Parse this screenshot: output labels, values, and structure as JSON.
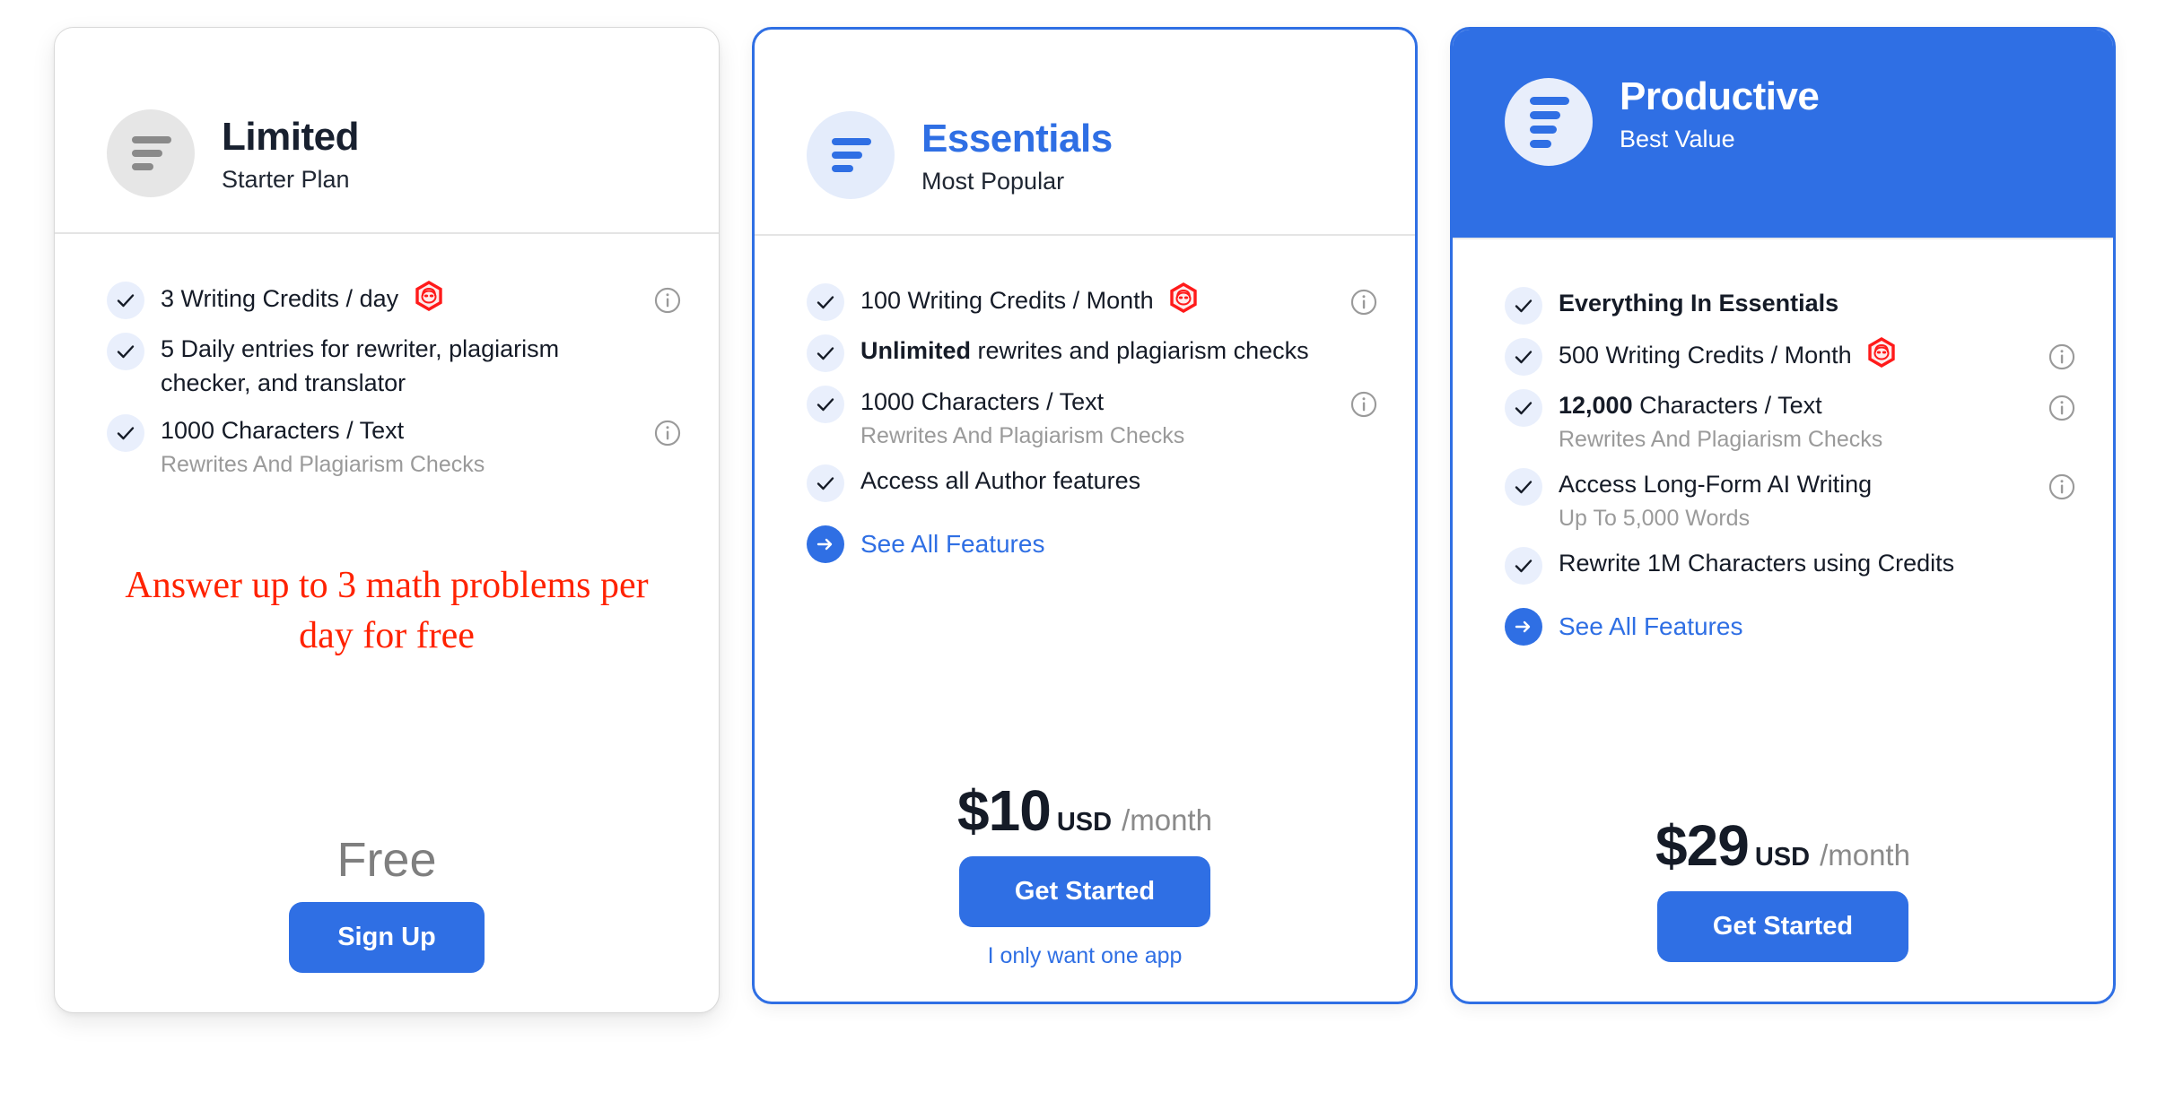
{
  "theme": {
    "accent": "#2f6fe4",
    "promo_red": "#ff2200",
    "muted": "#9a9a9a",
    "check_bg": "#e9effc"
  },
  "plans": [
    {
      "id": "limited",
      "name": "Limited",
      "subtitle": "Starter Plan",
      "badge_icon": "lines-icon",
      "features": [
        {
          "text": "3 Writing Credits / day",
          "bold_prefix": "",
          "note": "",
          "robot": true,
          "info": true
        },
        {
          "text": "5 Daily entries for rewriter, plagiarism checker, and translator",
          "bold_prefix": "",
          "note": "",
          "robot": false,
          "info": false
        },
        {
          "text": "1000 Characters / Text",
          "bold_prefix": "",
          "note": "Rewrites And Plagiarism Checks",
          "robot": false,
          "info": true
        }
      ],
      "see_all": null,
      "promo": "Answer up to 3 math problems per day for free",
      "price_free_label": "Free",
      "price_amount": "",
      "price_currency": "",
      "price_period": "",
      "cta_label": "Sign Up",
      "alt_link": ""
    },
    {
      "id": "essentials",
      "name": "Essentials",
      "subtitle": "Most Popular",
      "badge_icon": "lines-icon",
      "features": [
        {
          "text": "100 Writing Credits / Month",
          "bold_prefix": "",
          "note": "",
          "robot": true,
          "info": true
        },
        {
          "text": " rewrites and plagiarism checks",
          "bold_prefix": "Unlimited",
          "note": "",
          "robot": false,
          "info": false
        },
        {
          "text": "1000 Characters / Text",
          "bold_prefix": "",
          "note": "Rewrites And Plagiarism Checks",
          "robot": false,
          "info": true
        },
        {
          "text": "Access all Author features",
          "bold_prefix": "",
          "note": "",
          "robot": false,
          "info": false
        }
      ],
      "see_all": "See All Features",
      "promo": "",
      "price_free_label": "",
      "price_amount": "$10",
      "price_currency": "USD",
      "price_period": "/month",
      "cta_label": "Get Started",
      "alt_link": "I only want one app"
    },
    {
      "id": "productive",
      "name": "Productive",
      "subtitle": "Best Value",
      "badge_icon": "lines-icon",
      "features": [
        {
          "text": "",
          "bold_prefix": "Everything In Essentials",
          "note": "",
          "robot": false,
          "info": false
        },
        {
          "text": "500 Writing Credits / Month",
          "bold_prefix": "",
          "note": "",
          "robot": true,
          "info": true
        },
        {
          "text": " Characters / Text",
          "bold_prefix": "12,000",
          "note": "Rewrites And Plagiarism Checks",
          "robot": false,
          "info": true
        },
        {
          "text": "Access Long-Form AI Writing",
          "bold_prefix": "",
          "note": "Up To 5,000 Words",
          "robot": false,
          "info": true
        },
        {
          "text": "Rewrite 1M Characters using Credits",
          "bold_prefix": "",
          "note": "",
          "robot": false,
          "info": false
        }
      ],
      "see_all": "See All Features",
      "promo": "",
      "price_free_label": "",
      "price_amount": "$29",
      "price_currency": "USD",
      "price_period": "/month",
      "cta_label": "Get Started",
      "alt_link": ""
    }
  ]
}
